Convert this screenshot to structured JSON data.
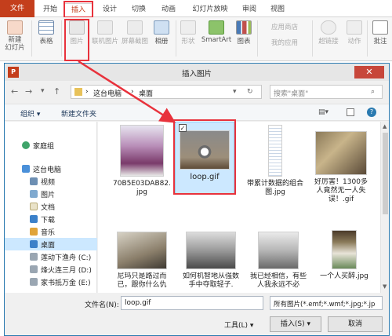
{
  "ribbon": {
    "tabs": [
      "文件",
      "开始",
      "插入",
      "设计",
      "切换",
      "动画",
      "幻灯片放映",
      "审阅",
      "视图"
    ],
    "buttons": [
      "新建\n幻灯片",
      "表格",
      "图片",
      "联机图片",
      "屏幕截图",
      "相册",
      "形状",
      "SmartArt",
      "图表",
      "应用商店",
      "我的应用",
      "超链接",
      "动作",
      "批注"
    ]
  },
  "dialog": {
    "title": "插入图片",
    "close": "✕",
    "address": [
      "这台电脑",
      "桌面"
    ],
    "search_placeholder": "搜索\"桌面\"",
    "organize": "组织 ▾",
    "new_folder": "新建文件夹",
    "nav": [
      "家庭组",
      "这台电脑",
      "视频",
      "图片",
      "文档",
      "下载",
      "音乐",
      "桌面",
      "莲动下渔舟 (C:)",
      "烽火连三月 (D:)",
      "家书抵万金 (E:)"
    ],
    "files": [
      {
        "name": "70B5E03DAB82.jpg"
      },
      {
        "name": "loop.gif"
      },
      {
        "name": "带累计数据的组合图.jpg"
      },
      {
        "name": "好厉害！1300多人竟然无一人失误！.gif"
      },
      {
        "name": "尼玛只是路过而已，跟你什么仇"
      },
      {
        "name": "如何机智地从强数手中夺取轻子."
      },
      {
        "name": "我已经相信，有些人我永远不必"
      },
      {
        "name": "一个人买醉.jpg"
      }
    ],
    "filename_label": "文件名(N):",
    "filename_value": "loop.gif",
    "filetype_value": "所有图片(*.emf;*.wmf;*.jpg;*.jp",
    "tools": "工具(L)",
    "insert": "插入(S)",
    "cancel": "取消"
  }
}
